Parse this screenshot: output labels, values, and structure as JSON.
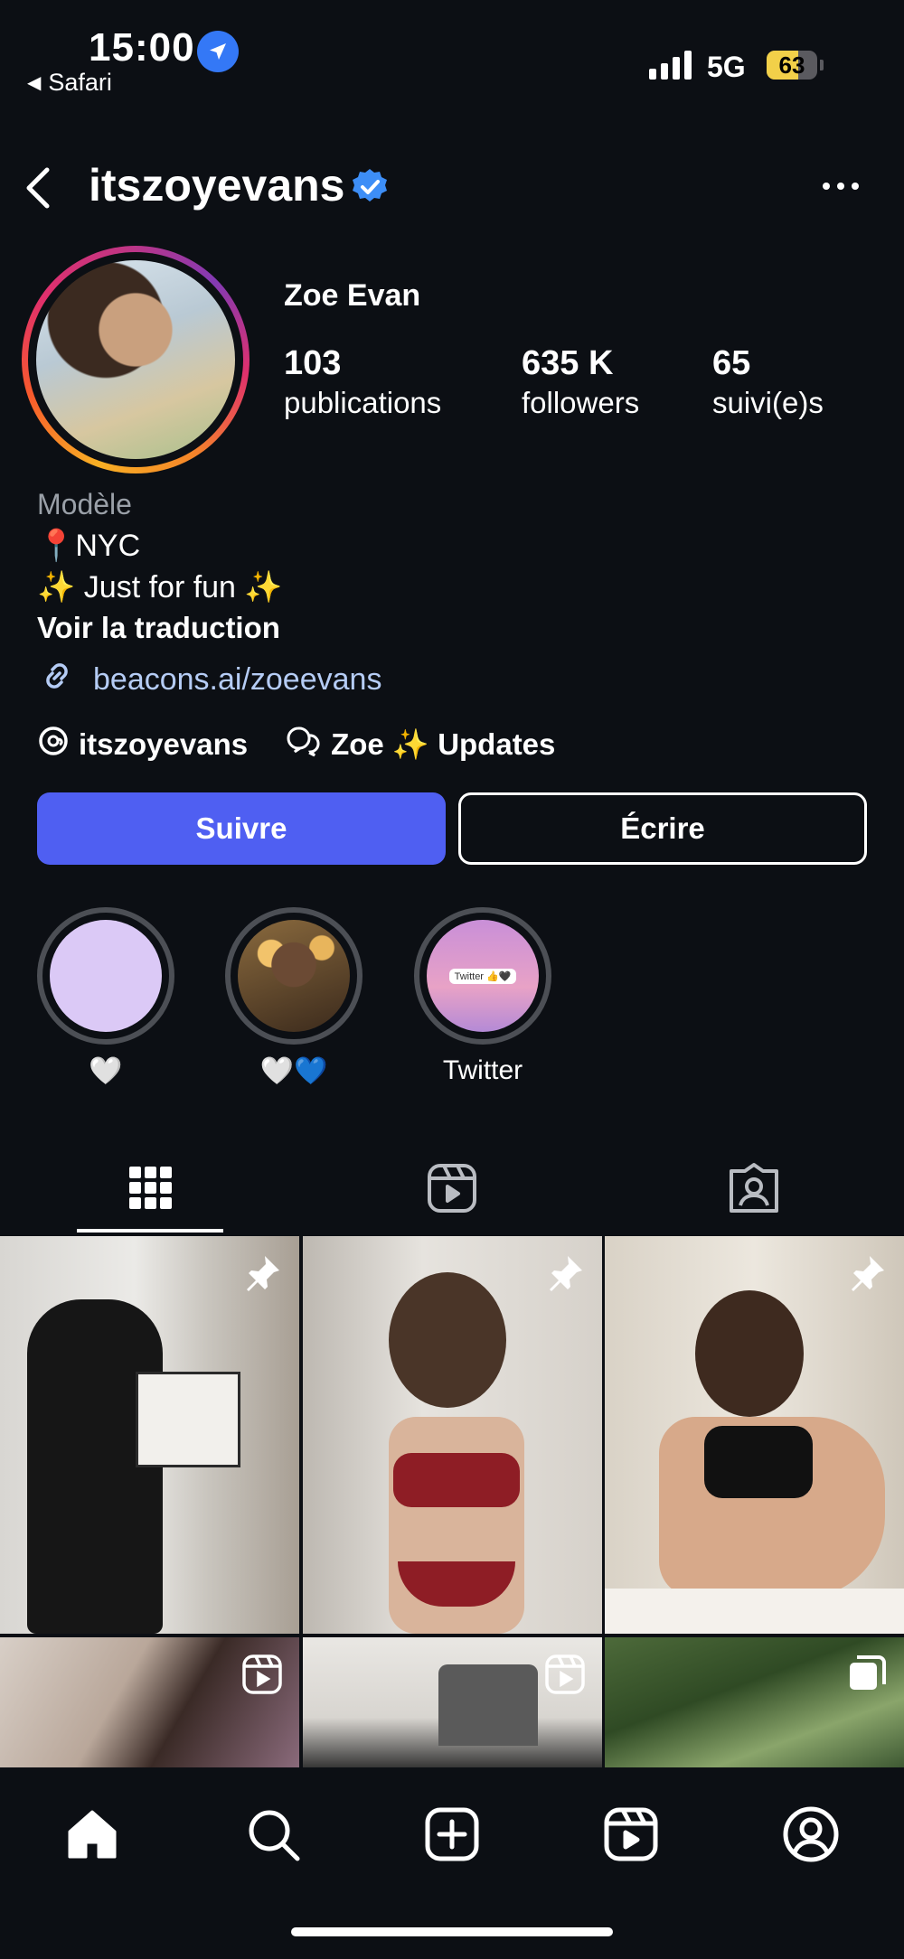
{
  "status_bar": {
    "time": "15:00",
    "back_app": "Safari",
    "network": "5G",
    "battery": "63",
    "battery_level": 0.63
  },
  "header": {
    "username": "itszoyevans"
  },
  "profile": {
    "full_name": "Zoe Evan",
    "stats": [
      {
        "value": "103",
        "label": "publications"
      },
      {
        "value": "635 K",
        "label": "followers"
      },
      {
        "value": "65",
        "label": "suivi(e)s"
      }
    ],
    "category": "Modèle",
    "bio_lines": [
      "📍NYC",
      "✨ Just for fun ✨"
    ],
    "translate_label": "Voir la traduction",
    "link": "beacons.ai/zoeevans",
    "threads_handle": "itszoyevans",
    "channel_name": "Zoe ✨ Updates"
  },
  "actions": {
    "follow_label": "Suivre",
    "message_label": "Écrire"
  },
  "highlights": [
    {
      "label": "🤍",
      "cover": "lavender"
    },
    {
      "label": "🤍💙",
      "cover": "photo"
    },
    {
      "label": "Twitter",
      "cover": "pink-sky",
      "cover_text": "Twitter 👍🖤"
    }
  ],
  "tabs": [
    {
      "name": "grid",
      "icon": "grid-icon",
      "active": true
    },
    {
      "name": "reels",
      "icon": "reels-icon",
      "active": false
    },
    {
      "name": "tagged",
      "icon": "tagged-icon",
      "active": false
    }
  ],
  "posts": [
    {
      "badge": "pin-icon",
      "tone": "mirror-selfie-black-dress"
    },
    {
      "badge": "pin-icon",
      "tone": "mirror-selfie-red"
    },
    {
      "badge": "pin-icon",
      "tone": "mirror-selfie-black"
    },
    {
      "badge": "reels-icon",
      "tone": "indoor-dark"
    },
    {
      "badge": "reels-icon",
      "tone": "lamp-dark"
    },
    {
      "badge": "carousel-icon",
      "tone": "palm-trees"
    }
  ],
  "bottom_nav": [
    "home-icon",
    "search-icon",
    "create-icon",
    "reels-icon",
    "profile-icon"
  ],
  "colors": {
    "background": "#0c0f14",
    "follow_button": "#4f5ff2",
    "link": "#b5ccf5",
    "verified": "#3d8ef7"
  }
}
